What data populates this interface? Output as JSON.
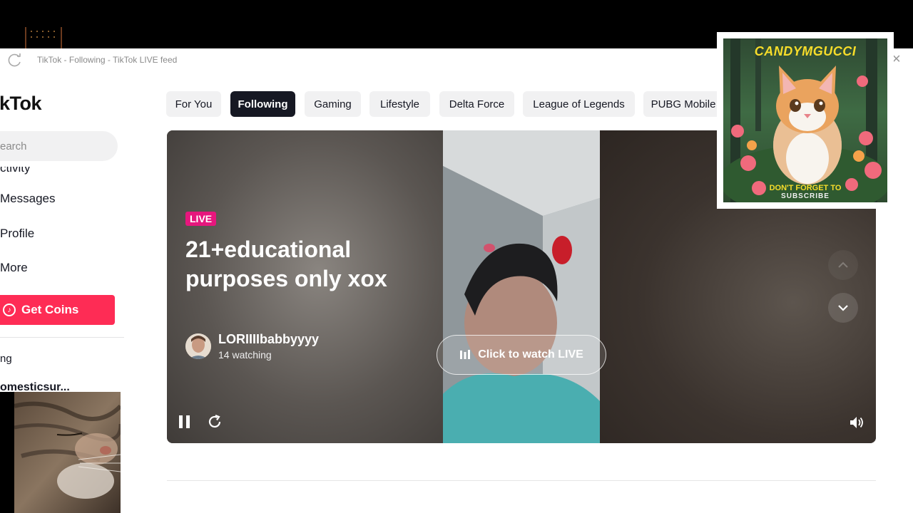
{
  "browser": {
    "tab_title": "TikTok - Following - TikTok LIVE feed"
  },
  "sidebar": {
    "brand": "ikTok",
    "search_placeholder": "earch",
    "partial_item": "ctivity",
    "items": [
      {
        "label": "Messages"
      },
      {
        "label": "Profile"
      },
      {
        "label": "More"
      }
    ],
    "get_coins_label": "Get Coins",
    "following_label": "ng",
    "following_user": "omesticsur..."
  },
  "categories": [
    {
      "label": "For You",
      "active": false
    },
    {
      "label": "Following",
      "active": true
    },
    {
      "label": "Gaming",
      "active": false
    },
    {
      "label": "Lifestyle",
      "active": false
    },
    {
      "label": "Delta Force",
      "active": false
    },
    {
      "label": "League of Legends",
      "active": false
    },
    {
      "label": "PUBG Mobile",
      "active": false
    }
  ],
  "live": {
    "badge": "LIVE",
    "title": "21+educational purposes only xox",
    "host_name": "LORIIIIbabbyyyy",
    "watching": "14 watching",
    "watch_button": "Click to watch LIVE"
  },
  "sticker": {
    "name": "CANDYMGUCCI",
    "line1": "DON'T FORGET TO",
    "line2": "SUBSCRIBE"
  },
  "colors": {
    "accent": "#fe2c55",
    "live_badge": "#e6167d",
    "chip_active": "#161823"
  }
}
